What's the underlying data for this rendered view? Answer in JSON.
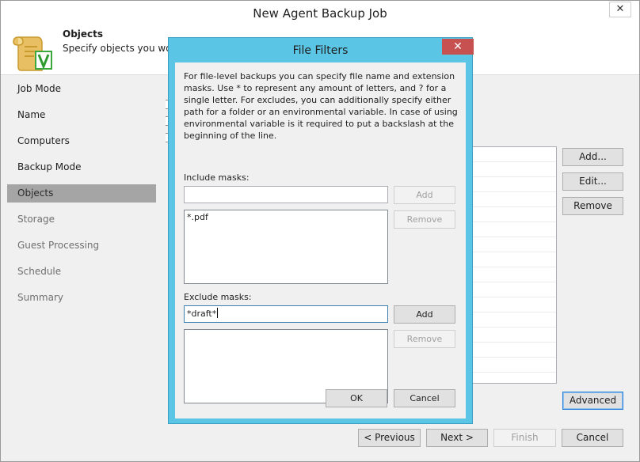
{
  "window": {
    "title": "New Agent Backup Job",
    "close_glyph": "✕"
  },
  "header": {
    "title": "Objects",
    "description": "Specify objects you woul"
  },
  "sidebar": {
    "steps": [
      {
        "label": "Job Mode"
      },
      {
        "label": "Name"
      },
      {
        "label": "Computers"
      },
      {
        "label": "Backup Mode"
      },
      {
        "label": "Objects"
      },
      {
        "label": "Storage"
      },
      {
        "label": "Guest Processing"
      },
      {
        "label": "Schedule"
      },
      {
        "label": "Summary"
      }
    ],
    "active_step": "Objects"
  },
  "objects_panel": {
    "add_label": "Add...",
    "edit_label": "Edit...",
    "remove_label": "Remove",
    "advanced_label": "Advanced"
  },
  "footer": {
    "previous_label": "< Previous",
    "next_label": "Next >",
    "finish_label": "Finish",
    "cancel_label": "Cancel"
  },
  "dialog": {
    "title": "File Filters",
    "close_glyph": "✕",
    "close_color": "#c75050",
    "accent_color": "#5bc5e6",
    "description": "For file-level backups you can specify file name and extension masks. Use * to represent any amount of letters, and ? for a single letter. For excludes, you can additionally specify either path for a folder or an environmental variable. In case of using environmental variable is it required to put a backslash at the beginning of the line.",
    "include": {
      "label": "Include masks:",
      "input_value": "",
      "add_label": "Add",
      "remove_label": "Remove",
      "items": [
        "*.pdf"
      ]
    },
    "exclude": {
      "label": "Exclude masks:",
      "input_value": "*draft*",
      "add_label": "Add",
      "remove_label": "Remove",
      "items": []
    },
    "ok_label": "OK",
    "cancel_label": "Cancel"
  }
}
